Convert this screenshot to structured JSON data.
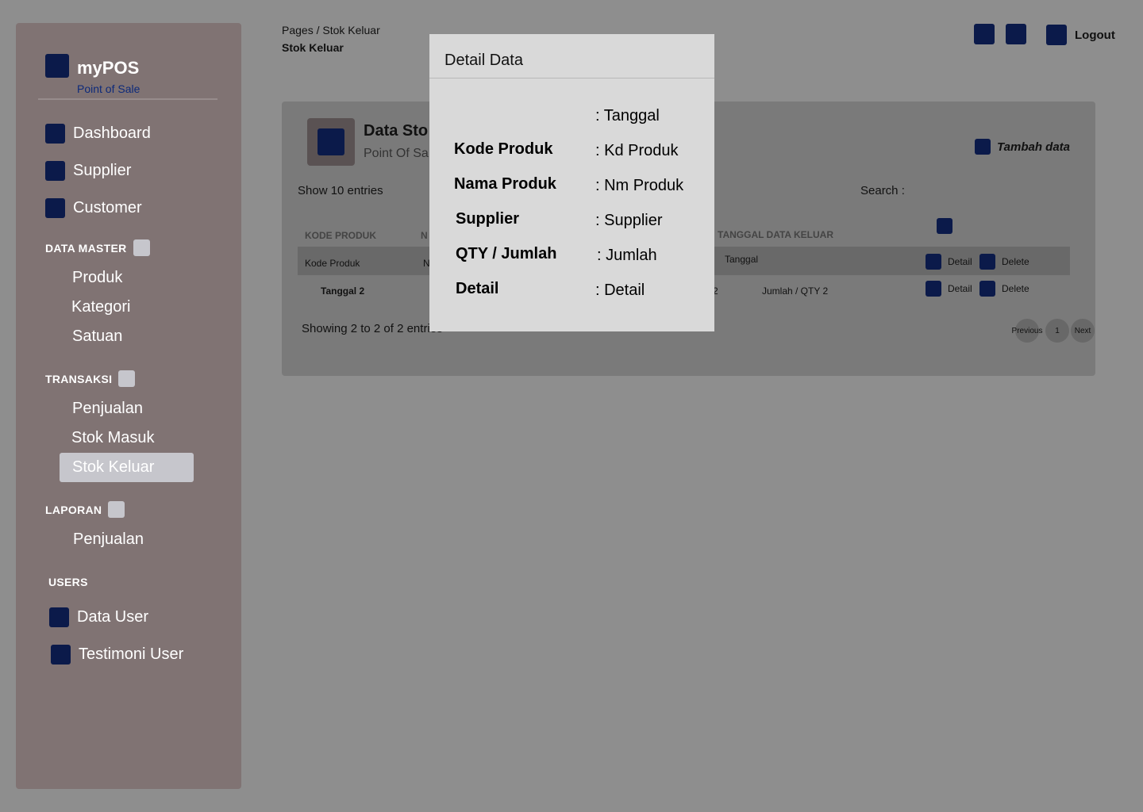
{
  "sidebar": {
    "brand_title": "myPOS",
    "brand_sub": "Point of Sale",
    "main_items": [
      "Dashboard",
      "Supplier",
      "Customer"
    ],
    "data_master_title": "DATA MASTER",
    "data_master_items": [
      "Produk",
      "Kategori",
      "Satuan"
    ],
    "transaksi_title": "TRANSAKSI",
    "transaksi_items": [
      "Penjualan",
      "Stok Masuk",
      "Stok Keluar"
    ],
    "laporan_title": "LAPORAN",
    "laporan_items": [
      "Penjualan"
    ],
    "users_title": "USERS",
    "users_items": [
      "Data User",
      "Testimoni User"
    ]
  },
  "header": {
    "breadcrumb": "Pages / Stok Keluar",
    "page_title": "Stok Keluar",
    "logout": "Logout"
  },
  "card": {
    "title": "Data Sto",
    "subtitle": "Point Of Sa",
    "add_label": "Tambah data",
    "show_entries": "Show 10  entries",
    "search_label": "Search :",
    "headers": {
      "kode_produk": "KODE PRODUK",
      "nama_partial": "N",
      "tanggal_keluar": "TANGGAL DATA KELUAR"
    },
    "rows": [
      {
        "kode": "Kode Produk",
        "nama_partial": "N",
        "tanggal": "Tanggal"
      },
      {
        "kode": "Tanggal 2",
        "partial": "2",
        "jumlah": "Jumlah / QTY 2"
      }
    ],
    "detail_label": "Detail",
    "delete_label": "Delete",
    "showing": "Showing 2 to 2 of 2 entries",
    "pagination": {
      "previous": "Previous",
      "page": "1",
      "next": "Next"
    }
  },
  "modal": {
    "title": "Detail Data",
    "fields": [
      {
        "label": "",
        "value": ": Tanggal"
      },
      {
        "label": "Kode Produk",
        "value": ": Kd Produk"
      },
      {
        "label": "Nama Produk",
        "value": ": Nm Produk"
      },
      {
        "label": "Supplier",
        "value": ": Supplier"
      },
      {
        "label": "QTY / Jumlah",
        "value": ": Jumlah"
      },
      {
        "label": "Detail",
        "value": ": Detail"
      }
    ]
  },
  "colors": {
    "page_bg": "#8e8e8e",
    "sidebar_bg": "#807373",
    "icon": "#0b1a4a",
    "active_item": "#c6c6cc",
    "modal_bg": "#d9d9d9"
  }
}
